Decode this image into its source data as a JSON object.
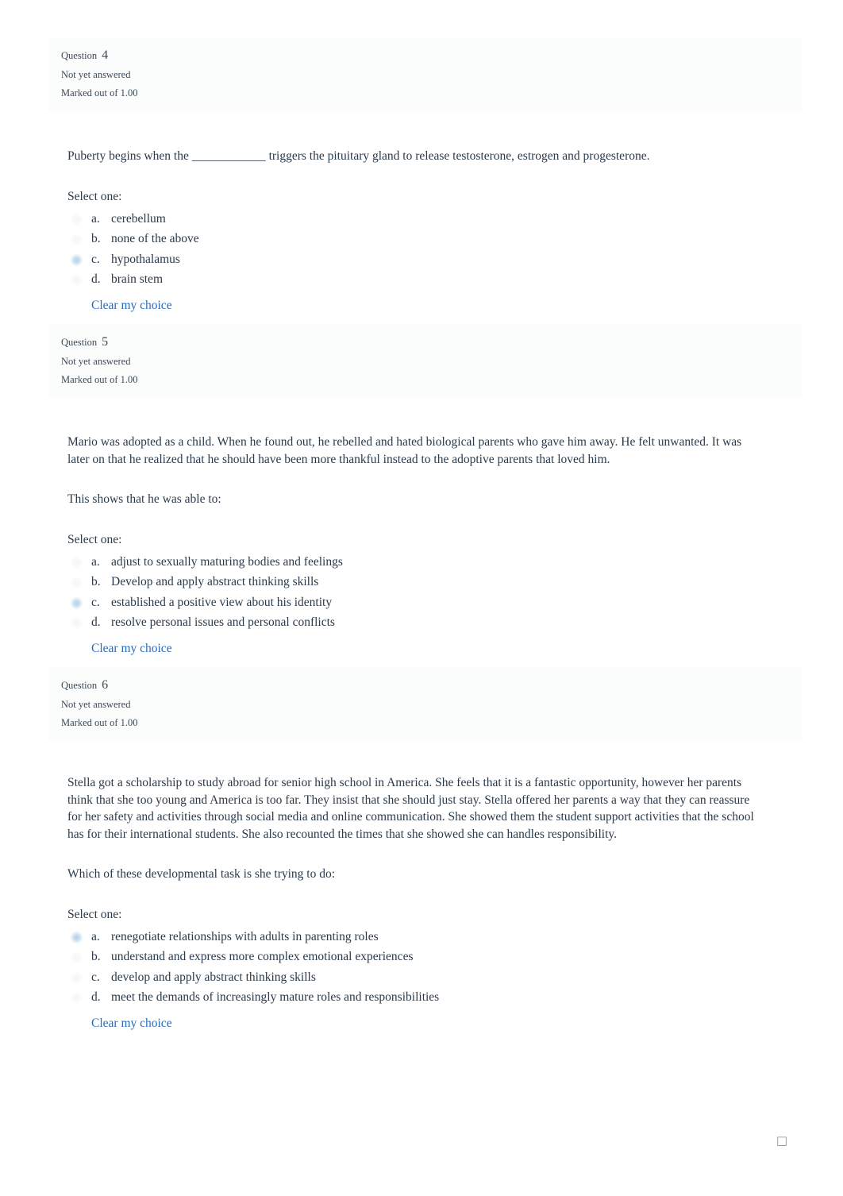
{
  "labels": {
    "question_word": "Question",
    "select_one": "Select one:",
    "clear_choice": "Clear my choice",
    "missing_glyph": "□"
  },
  "colors": {
    "text": "#2b3a4a",
    "link": "#2a6bb8",
    "panel_bg": "#fbfcfc",
    "radio_selected": "#9ec4e2",
    "page_bg": "#ffffff"
  },
  "questions": [
    {
      "number": "4",
      "state": "Not yet answered",
      "grade": "Marked out of 1.00",
      "paragraphs": [
        "Puberty begins when the ____________ triggers the pituitary gland to release testosterone, estrogen and progesterone."
      ],
      "select_one": "Select one:",
      "options": [
        {
          "letter": "a.",
          "text": "cerebellum",
          "selected": false
        },
        {
          "letter": "b.",
          "text": "none of the above",
          "selected": false
        },
        {
          "letter": "c.",
          "text": "hypothalamus",
          "selected": true
        },
        {
          "letter": "d.",
          "text": "brain stem",
          "selected": false
        }
      ],
      "clear_choice": "Clear my choice"
    },
    {
      "number": "5",
      "state": "Not yet answered",
      "grade": "Marked out of 1.00",
      "paragraphs": [
        "Mario was adopted as a child. When he found out, he rebelled and hated biological parents who gave him away. He felt unwanted. It was later on that he realized that he should have been more thankful instead to the adoptive parents that loved him.",
        "This shows that he was able to:"
      ],
      "select_one": "Select one:",
      "options": [
        {
          "letter": "a.",
          "text": "adjust to sexually maturing bodies and feelings",
          "selected": false
        },
        {
          "letter": "b.",
          "text": "Develop and apply abstract thinking skills",
          "selected": false
        },
        {
          "letter": "c.",
          "text": "established a positive view about his identity",
          "selected": true
        },
        {
          "letter": "d.",
          "text": "resolve personal issues and personal conflicts",
          "selected": false
        }
      ],
      "clear_choice": "Clear my choice"
    },
    {
      "number": "6",
      "state": "Not yet answered",
      "grade": "Marked out of 1.00",
      "paragraphs": [
        "Stella got a scholarship to study abroad for senior high school in America. She feels that it is a fantastic opportunity, however her parents think that she too young and America is too far. They insist that she should just stay. Stella offered her parents a way that they can reassure for her safety and activities through social media and online communication. She showed them the student support activities that the school has for their international students. She also recounted the times that she showed she can handles responsibility.",
        "Which of these developmental task is she trying to do:"
      ],
      "select_one": "Select one:",
      "options": [
        {
          "letter": "a.",
          "text": "renegotiate relationships with adults in parenting roles",
          "selected": true
        },
        {
          "letter": "b.",
          "text": "understand and express more complex emotional experiences",
          "selected": false
        },
        {
          "letter": "c.",
          "text": "develop and apply abstract thinking skills",
          "selected": false
        },
        {
          "letter": "d.",
          "text": "meet the demands of increasingly mature roles and responsibilities",
          "selected": false
        }
      ],
      "clear_choice": "Clear my choice"
    }
  ]
}
